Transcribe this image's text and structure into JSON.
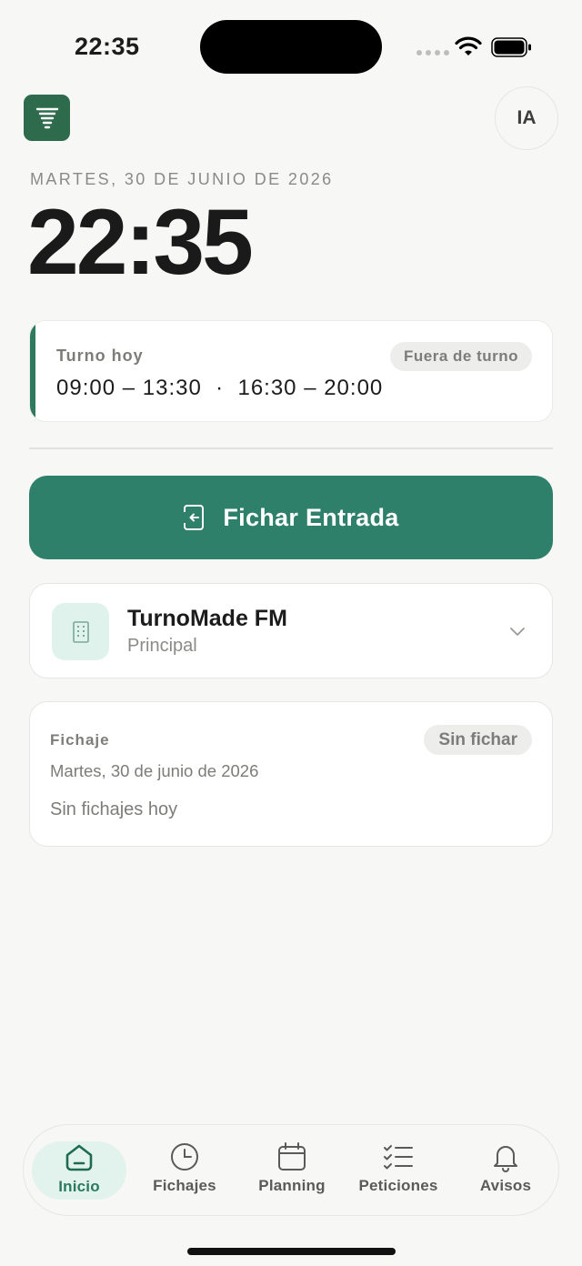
{
  "status_bar": {
    "time": "22:35"
  },
  "header": {
    "logo_icon": "tornado-icon",
    "avatar_initials": "IA"
  },
  "today": {
    "date_line": "MARTES, 30 DE JUNIO DE 2026",
    "clock": "22:35"
  },
  "shift": {
    "label": "Turno hoy",
    "status": "Fuera de turno",
    "hours": "09:00 – 13:30  ·  16:30 – 20:00"
  },
  "clock_in_button": {
    "label": "Fichar Entrada",
    "icon": "sign-in-icon"
  },
  "company": {
    "name": "TurnoMade FM",
    "location": "Principal",
    "icon": "building-icon"
  },
  "fichaje": {
    "title": "Fichaje",
    "status": "Sin fichar",
    "date": "Martes, 30 de junio de 2026",
    "empty_text": "Sin fichajes hoy"
  },
  "tabs": [
    {
      "label": "Inicio",
      "icon": "home-icon",
      "active": true
    },
    {
      "label": "Fichajes",
      "icon": "clock-icon",
      "active": false
    },
    {
      "label": "Planning",
      "icon": "calendar-icon",
      "active": false
    },
    {
      "label": "Peticiones",
      "icon": "checklist-icon",
      "active": false
    },
    {
      "label": "Avisos",
      "icon": "bell-icon",
      "active": false
    }
  ],
  "colors": {
    "brand_green": "#2e806a",
    "accent_bar": "#2e7a5c",
    "active_tab_bg": "#e2f2ec"
  }
}
